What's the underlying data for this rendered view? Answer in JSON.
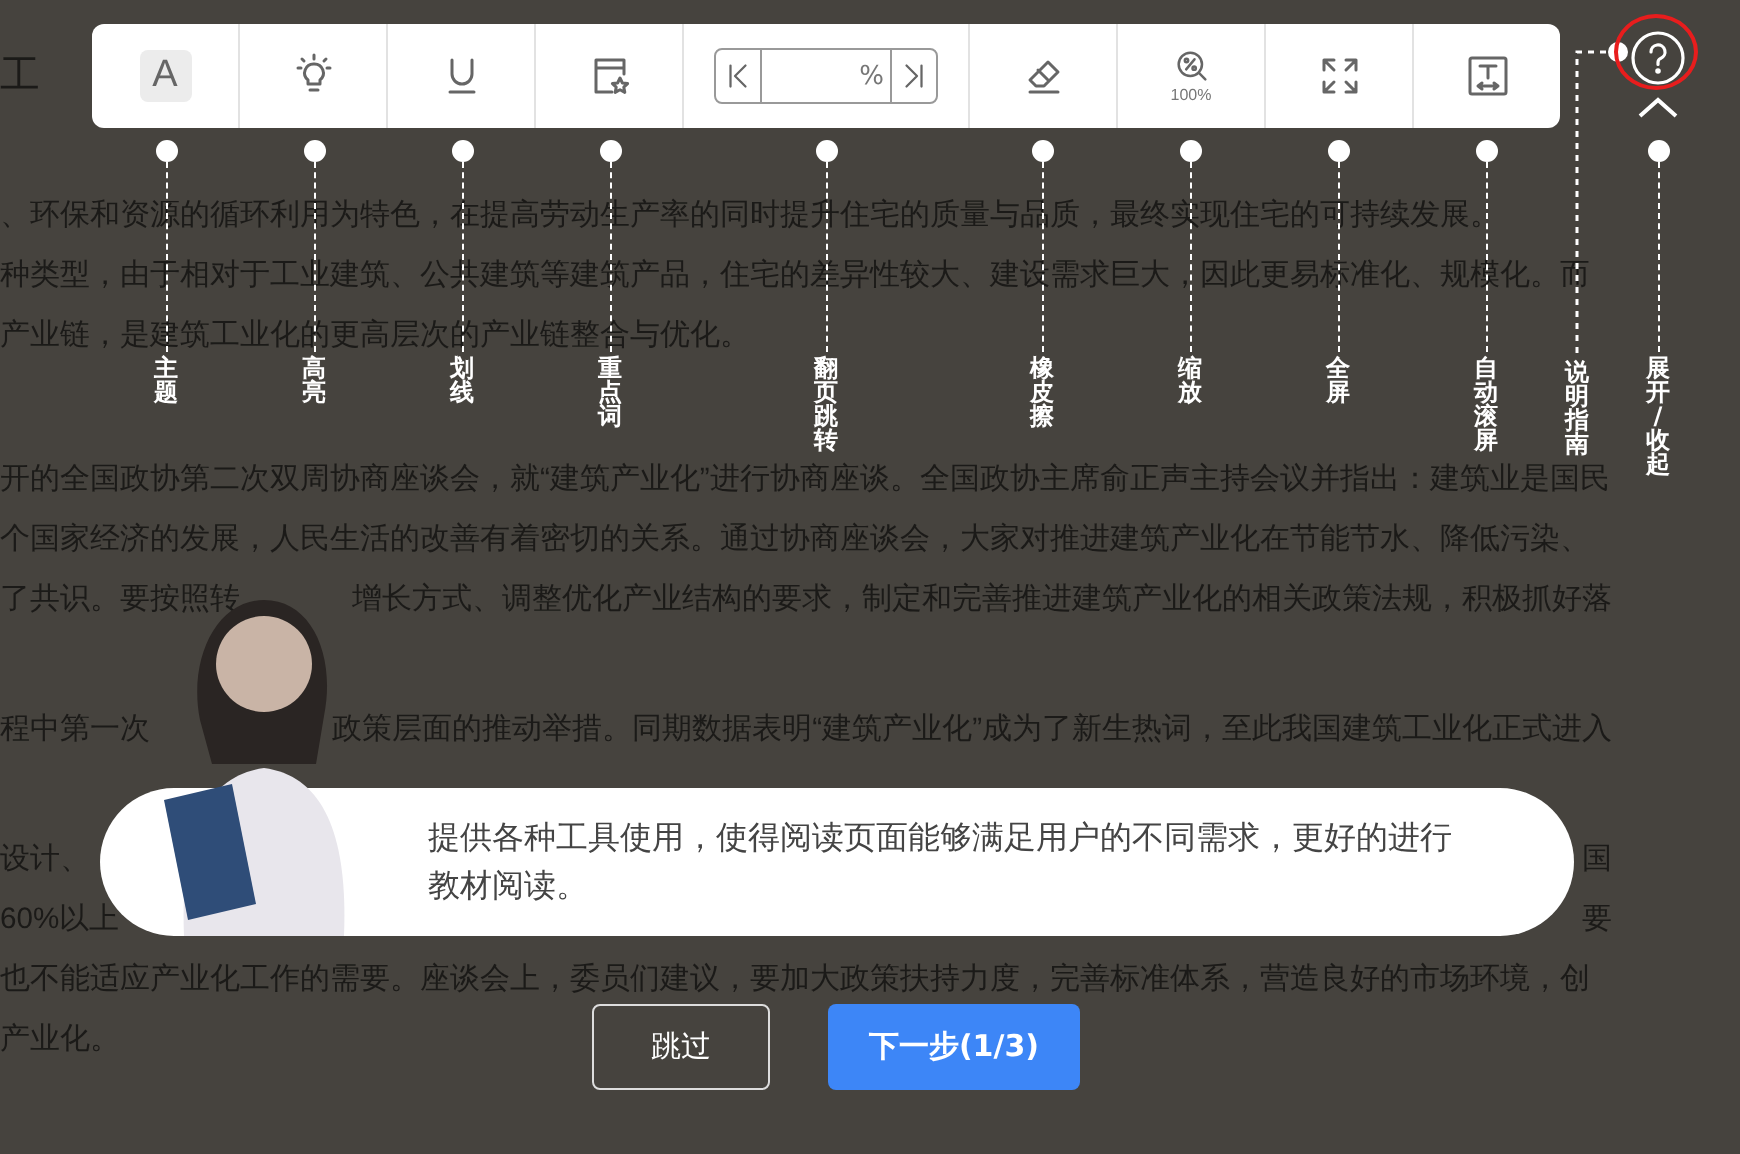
{
  "article": {
    "title": "工",
    "paragraphs": [
      {
        "lines": [
          [
            "、环保和资源的循环利用为特色，在提高劳动生产率的同时提升住宅的质量与品质，最终实现住宅的可持续发展。"
          ],
          [
            "种类型，由于相对于工业建筑、公共建筑等建筑产品，住宅的差异性较大、建设需求巨大，因此更易标准化、规模化。而"
          ],
          [
            "产业链，是建筑工业化的更高层次的产业链整合与优化。"
          ]
        ]
      },
      {
        "lines": [
          [
            "开的全国政协第二次双周协商座谈会，就“建筑产业化”进行协商座谈。全国政协主席俞正声主持会议并指出：建筑业是国民"
          ],
          [
            "个国家经济的发展，人民生活的改善有着密切的关系。通过协商座谈会，大家对推进建筑产业化在节能节水、降低污染、"
          ],
          [
            "了共识。要按照转",
            "增长方式、调整优化产业结构的要求，制定和完善推进建筑产业化的相关政策法规，积极抓好落"
          ]
        ]
      },
      {
        "lines": [
          [
            "程中第一次",
            "政策层面的推动举措。同期数据表明“建筑产业化”成为了新生热词，至此我国建筑工业化正式进入"
          ]
        ]
      },
      {
        "lines": [
          [
            "设计、",
            "国"
          ],
          [
            "60%以上",
            "要"
          ],
          [
            "也不能适应产业化工作的需要。座谈会上，委员们建议，要加大政策扶持力度，完善标准体系，营造良好的市场环境，创"
          ],
          [
            "产业化。"
          ]
        ]
      }
    ]
  },
  "toolbar": {
    "tools": [
      {
        "kind": "theme",
        "glyph": "A"
      },
      {
        "kind": "highlight"
      },
      {
        "kind": "underline"
      },
      {
        "kind": "keyword"
      },
      {
        "kind": "page_jump",
        "unit": "%"
      },
      {
        "kind": "eraser"
      },
      {
        "kind": "zoom",
        "reading": "100%"
      },
      {
        "kind": "fullscreen"
      },
      {
        "kind": "autoscroll"
      }
    ]
  },
  "help": {
    "highlighted": true
  },
  "guide": {
    "callouts": [
      {
        "label": "主题",
        "kind": "tool"
      },
      {
        "label": "高亮",
        "kind": "tool"
      },
      {
        "label": "划线",
        "kind": "tool"
      },
      {
        "label": "重点词",
        "kind": "tool"
      },
      {
        "label": "翻页跳转",
        "kind": "tool"
      },
      {
        "label": "橡皮擦",
        "kind": "tool"
      },
      {
        "label": "缩放",
        "kind": "tool"
      },
      {
        "label": "全屏",
        "kind": "tool"
      },
      {
        "label": "自动滚屏",
        "kind": "tool"
      },
      {
        "label": "说明指南",
        "kind": "help"
      },
      {
        "label": "展开/收起",
        "kind": "toggle"
      }
    ],
    "message": "提供各种工具使用，使得阅读页面能够满足用户的不同需求，更好的进行教材阅读。",
    "buttons": [
      {
        "label": "跳过",
        "kind": "secondary"
      },
      {
        "label": "下一步(1/3)",
        "kind": "primary"
      }
    ]
  }
}
